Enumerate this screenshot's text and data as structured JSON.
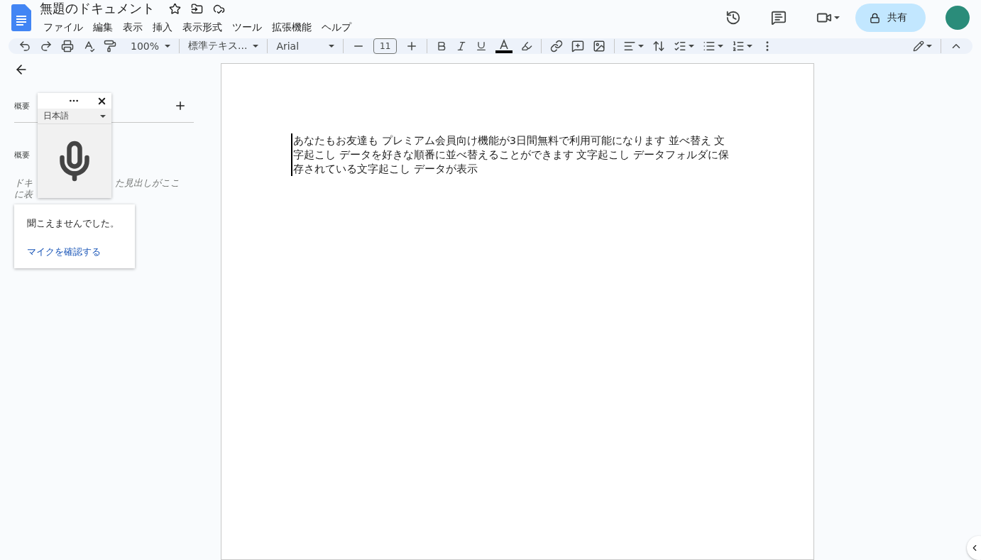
{
  "document": {
    "title": "無題のドキュメント"
  },
  "menu": [
    "ファイル",
    "編集",
    "表示",
    "挿入",
    "表示形式",
    "ツール",
    "拡張機能",
    "ヘルプ"
  ],
  "share_button": "共有",
  "toolbar": {
    "zoom": "100%",
    "style": "標準テキス...",
    "font": "Arial",
    "font_size": "11"
  },
  "sidebar": {
    "tab_label": "概要",
    "heading": "概要",
    "hint_parts": [
      "ドキ",
      "た見出しがここ",
      "に表"
    ]
  },
  "voice_typing": {
    "language": "日本語",
    "message": "聞こえませんでした。",
    "link": "マイクを確認する"
  },
  "page": {
    "text": "あなたもお友達も プレミアム会員向け機能が3日間無料で利用可能になります 並べ替え 文字起こし データを好きな順番に並べ替えることができます 文字起こし データフォルダに保存されている文字起こし データが表示"
  }
}
